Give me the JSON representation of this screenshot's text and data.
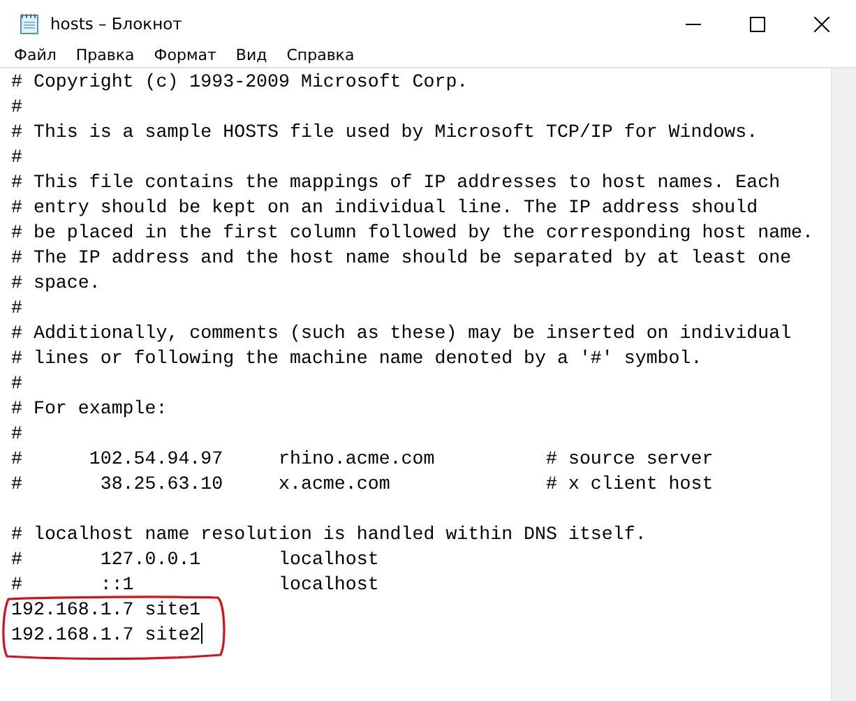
{
  "window": {
    "title": "hosts – Блокнот"
  },
  "menu": [
    "Файл",
    "Правка",
    "Формат",
    "Вид",
    "Справка"
  ],
  "editor": {
    "blocks": [
      [
        "# Copyright (c) 1993-2009 Microsoft Corp.",
        "#",
        "# This is a sample HOSTS file used by Microsoft TCP/IP for Windows.",
        "#",
        "# This file contains the mappings of IP addresses to host names. Each",
        "# entry should be kept on an individual line. The IP address should",
        "# be placed in the first column followed by the corresponding host name.",
        "# The IP address and the host name should be separated by at least one",
        "# space.",
        "#",
        "# Additionally, comments (such as these) may be inserted on individual",
        "# lines or following the machine name denoted by a '#' symbol.",
        "#",
        "# For example:",
        "#",
        "#      102.54.94.97     rhino.acme.com          # source server",
        "#       38.25.63.10     x.acme.com              # x client host"
      ],
      [
        "# localhost name resolution is handled within DNS itself.",
        "#\t127.0.0.1       localhost",
        "#\t::1             localhost",
        "192.168.1.7 site1",
        "192.168.1.7 site2"
      ]
    ]
  }
}
